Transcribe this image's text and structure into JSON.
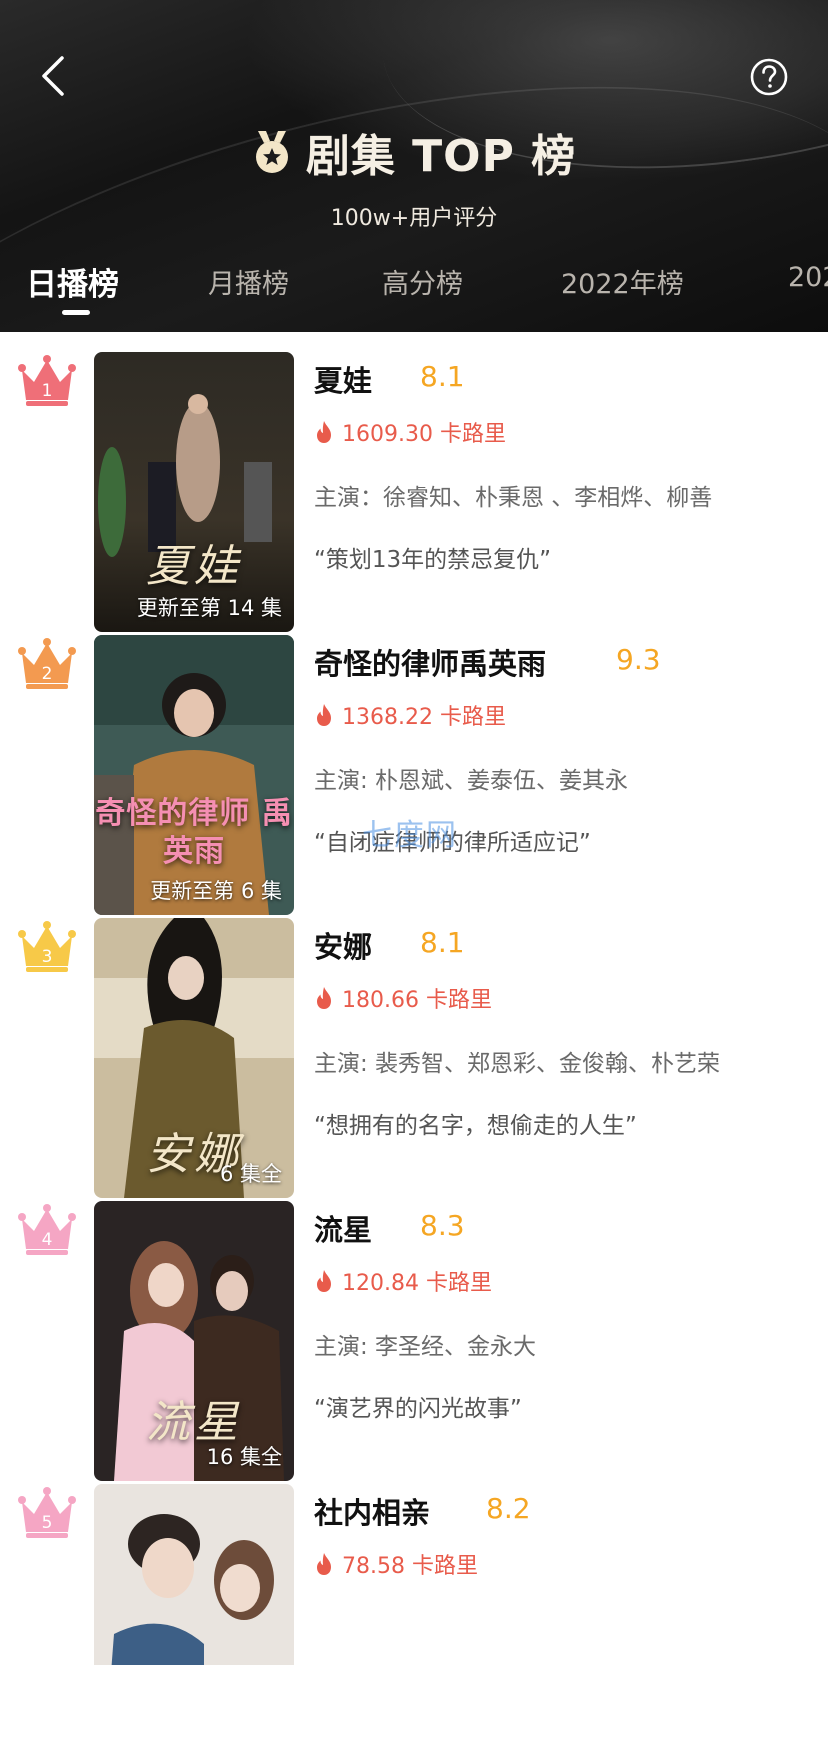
{
  "header": {
    "title": "剧集 TOP 榜",
    "subtitle": "100w+用户评分",
    "tabs": [
      {
        "label": "日播榜",
        "active": true
      },
      {
        "label": "月播榜",
        "active": false
      },
      {
        "label": "高分榜",
        "active": false
      },
      {
        "label": "2022年榜",
        "active": false
      },
      {
        "label": "202",
        "active": false
      }
    ]
  },
  "colors": {
    "score": "#f5a623",
    "heat": "#e85b4b",
    "rank1": "#ef6f78",
    "rank2": "#f39a50",
    "rank3": "#f7c948",
    "rank4": "#f5a6c4",
    "rank5": "#f5a6c4"
  },
  "items": [
    {
      "rank": "1",
      "title": "夏娃",
      "score": "8.1",
      "heat": "1609.30 卡路里",
      "cast": "主演：徐睿知、朴秉恩 、李相烨、柳善",
      "quote": "“策划13年的禁忌复仇”",
      "episode": "更新至第 14 集",
      "poster_text": "夏娃"
    },
    {
      "rank": "2",
      "title": "奇怪的律师禹英雨",
      "score": "9.3",
      "heat": "1368.22 卡路里",
      "cast": "主演: 朴恩斌、姜泰伍、姜其永",
      "quote": "“自闭症律师的律所适应记”",
      "episode": "更新至第 6 集",
      "poster_text": "奇怪的律师 禹英雨"
    },
    {
      "rank": "3",
      "title": "安娜",
      "score": "8.1",
      "heat": "180.66 卡路里",
      "cast": "主演: 裴秀智、郑恩彩、金俊翰、朴艺荣",
      "quote": "“想拥有的名字，想偷走的人生”",
      "episode": "6 集全",
      "poster_text": "安娜"
    },
    {
      "rank": "4",
      "title": "流星",
      "score": "8.3",
      "heat": "120.84 卡路里",
      "cast": "主演: 李圣经、金永大",
      "quote": "“演艺界的闪光故事”",
      "episode": "16 集全",
      "poster_text": "流星"
    },
    {
      "rank": "5",
      "title": "社内相亲",
      "score": "8.2",
      "heat": "78.58 卡路里",
      "cast": "",
      "quote": "",
      "episode": "",
      "poster_text": ""
    }
  ],
  "watermark": "七度网",
  "icons": {
    "back": "chevron-left-icon",
    "help": "question-circle-icon",
    "medal": "medal-icon",
    "crown": "crown-icon",
    "fire": "fire-icon"
  }
}
